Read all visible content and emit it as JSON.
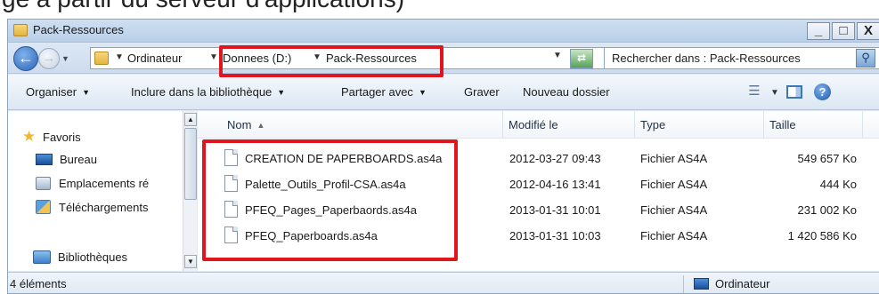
{
  "caption": "ge à partir du serveur d'applications)",
  "window": {
    "title": "Pack-Ressources",
    "buttons": {
      "minimize": "_",
      "maximize": "□",
      "close": "X"
    }
  },
  "address": {
    "crumbs": [
      "Ordinateur",
      "Donnees (D:)",
      "Pack-Ressources"
    ],
    "search_placeholder": "Rechercher dans : Pack-Ressources"
  },
  "toolbar": {
    "organize": "Organiser",
    "include_library": "Inclure dans la bibliothèque",
    "share_with": "Partager avec",
    "burn": "Graver",
    "new_folder": "Nouveau dossier"
  },
  "nav_pane": {
    "favorites": "Favoris",
    "items": [
      "Bureau",
      "Emplacements ré",
      "Téléchargements"
    ],
    "libraries": "Bibliothèques"
  },
  "columns": {
    "name": "Nom",
    "modified": "Modifié le",
    "type": "Type",
    "size": "Taille"
  },
  "files": [
    {
      "name": "CREATION DE PAPERBOARDS.as4a",
      "modified": "2012-03-27 09:43",
      "type": "Fichier AS4A",
      "size": "549 657 Ko"
    },
    {
      "name": "Palette_Outils_Profil-CSA.as4a",
      "modified": "2012-04-16 13:41",
      "type": "Fichier AS4A",
      "size": "444 Ko"
    },
    {
      "name": "PFEQ_Pages_Paperbaords.as4a",
      "modified": "2013-01-31 10:01",
      "type": "Fichier AS4A",
      "size": "231 002 Ko"
    },
    {
      "name": "PFEQ_Paperboards.as4a",
      "modified": "2013-01-31 10:03",
      "type": "Fichier AS4A",
      "size": "1 420 586 Ko"
    }
  ],
  "status": {
    "count": "4 éléments",
    "location": "Ordinateur"
  },
  "colors": {
    "highlight": "#e0161f",
    "window_frame": "#dfe9f5"
  }
}
